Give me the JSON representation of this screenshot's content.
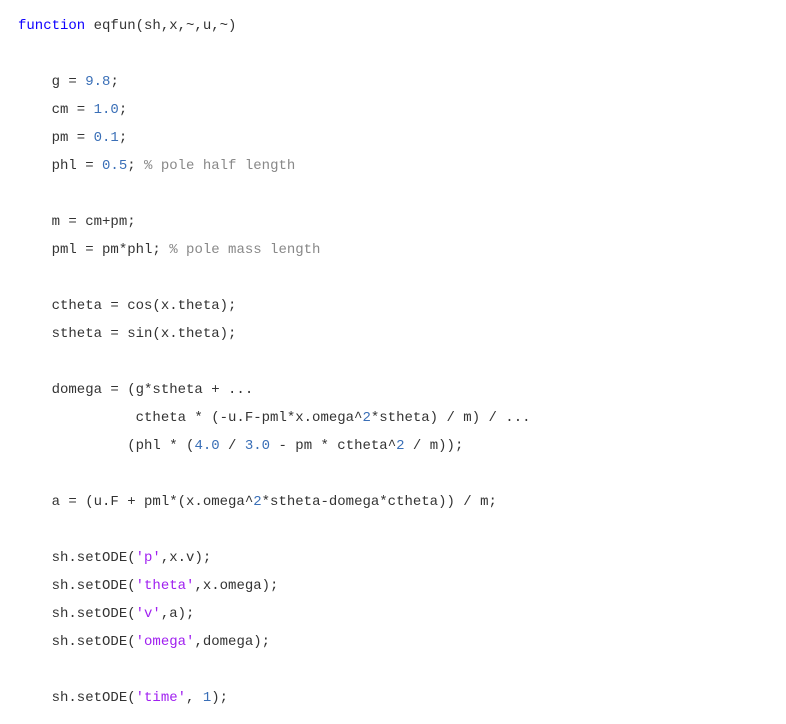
{
  "code": {
    "line01_kw": "function",
    "line01_rest": " eqfun(sh,x,~,u,~)",
    "blank": "",
    "line03_a": "    g = ",
    "line03_n": "9.8",
    "line03_b": ";",
    "line04_a": "    cm = ",
    "line04_n": "1.0",
    "line04_b": ";",
    "line05_a": "    pm = ",
    "line05_n": "0.1",
    "line05_b": ";",
    "line06_a": "    phl = ",
    "line06_n": "0.5",
    "line06_b": "; ",
    "line06_c": "% pole half length",
    "line08": "    m = cm+pm;",
    "line09_a": "    pml = pm*phl; ",
    "line09_c": "% pole mass length",
    "line11": "    ctheta = cos(x.theta);",
    "line12": "    stheta = sin(x.theta);",
    "line14": "    domega = (g*stheta + ...",
    "line15_a": "              ctheta * (-u.F-pml*x.omega^",
    "line15_n": "2",
    "line15_b": "*stheta) / m) / ...",
    "line16_a": "             (phl * (",
    "line16_n1": "4.0",
    "line16_b": " / ",
    "line16_n2": "3.0",
    "line16_c": " - pm * ctheta^",
    "line16_n3": "2",
    "line16_d": " / m));",
    "line18_a": "    a = (u.F + pml*(x.omega^",
    "line18_n1": "2",
    "line18_b": "*stheta-domega*ctheta)) / m;",
    "line20_a": "    sh.setODE(",
    "line20_s": "'p'",
    "line20_b": ",x.v);",
    "line21_a": "    sh.setODE(",
    "line21_s": "'theta'",
    "line21_b": ",x.omega);",
    "line22_a": "    sh.setODE(",
    "line22_s": "'v'",
    "line22_b": ",a);",
    "line23_a": "    sh.setODE(",
    "line23_s": "'omega'",
    "line23_b": ",domega);",
    "line25_a": "    sh.setODE(",
    "line25_s": "'time'",
    "line25_b": ", ",
    "line25_n": "1",
    "line25_c": ");"
  }
}
